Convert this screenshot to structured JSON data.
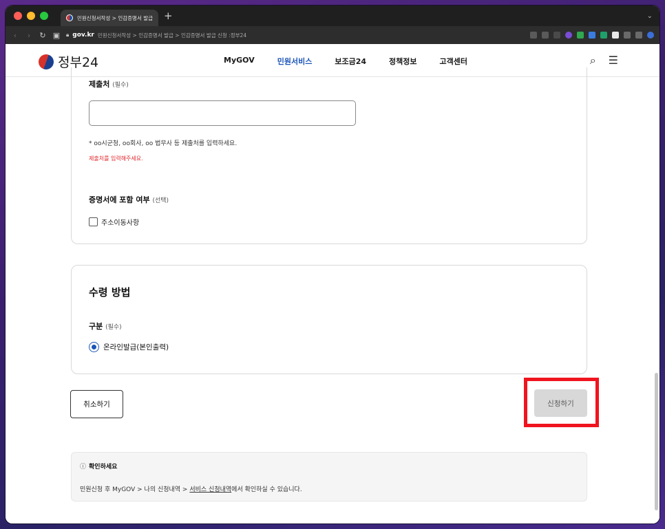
{
  "browser": {
    "tab_title": "민원신청서작성 > 인감증명서 발급",
    "new_tab": "+",
    "url_domain": "gov.kr",
    "url_path": "민원신청서작성 > 인감증명서 발급 > 인감증명서 발급 신청 :정부24"
  },
  "header": {
    "logo_text": "정부24",
    "nav": [
      {
        "label": "MyGOV"
      },
      {
        "label": "민원서비스"
      },
      {
        "label": "보조금24"
      },
      {
        "label": "정책정보"
      },
      {
        "label": "고객센터"
      }
    ],
    "active_nav": "민원서비스"
  },
  "form": {
    "submit_to_label": "제출처",
    "submit_to_required": "(필수)",
    "submit_to_value": "",
    "submit_to_hint": "* oo시군청, oo회사, oo 법무사 등 제출처를 입력하세요.",
    "submit_to_error": "제출처를 입력해주세요.",
    "include_label": "증명서에 포함 여부",
    "include_optional": "(선택)",
    "include_option": "주소이동사항",
    "include_checked": false
  },
  "receipt": {
    "title": "수령 방법",
    "type_label": "구분",
    "type_required": "(필수)",
    "option": "온라인발급(본인출력)",
    "selected": true
  },
  "actions": {
    "cancel_label": "취소하기",
    "submit_label": "신청하기"
  },
  "notice": {
    "title": "확인하세요",
    "text_before": "민원신청 후 MyGOV > 나의 신청내역 > ",
    "link": "서비스 신청내역",
    "text_after": "에서 확인하실 수 있습니다."
  },
  "colors": {
    "accent": "#1b54b8",
    "error": "#e0282e",
    "highlight": "#f0141e"
  }
}
